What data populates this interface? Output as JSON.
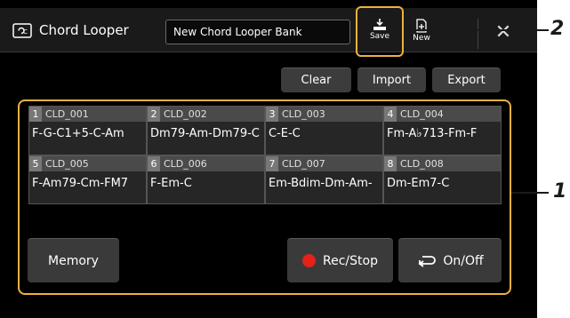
{
  "header": {
    "title": "Chord Looper",
    "bank_name": "New Chord Looper Bank",
    "save_label": "Save",
    "new_label": "New",
    "close_symbol": "✕"
  },
  "actions": {
    "clear": "Clear",
    "import": "Import",
    "export": "Export"
  },
  "cells": [
    {
      "num": "1",
      "name": "CLD_001",
      "chords": "F-G-C1+5-C-Am"
    },
    {
      "num": "2",
      "name": "CLD_002",
      "chords": "Dm79-Am-Dm79-C"
    },
    {
      "num": "3",
      "name": "CLD_003",
      "chords": "C-E-C"
    },
    {
      "num": "4",
      "name": "CLD_004",
      "chords": "Fm-A♭713-Fm-F"
    },
    {
      "num": "5",
      "name": "CLD_005",
      "chords": "F-Am79-Cm-FM7"
    },
    {
      "num": "6",
      "name": "CLD_006",
      "chords": "F-Em-C"
    },
    {
      "num": "7",
      "name": "CLD_007",
      "chords": "Em-Bdim-Dm-Am-"
    },
    {
      "num": "8",
      "name": "CLD_008",
      "chords": "Dm-Em7-C"
    }
  ],
  "footer": {
    "memory": "Memory",
    "rec_stop": "Rec/Stop",
    "on_off": "On/Off"
  },
  "callouts": {
    "one": "1",
    "two": "2"
  },
  "colors": {
    "highlight": "#f0b040",
    "rec": "#e4211b"
  }
}
